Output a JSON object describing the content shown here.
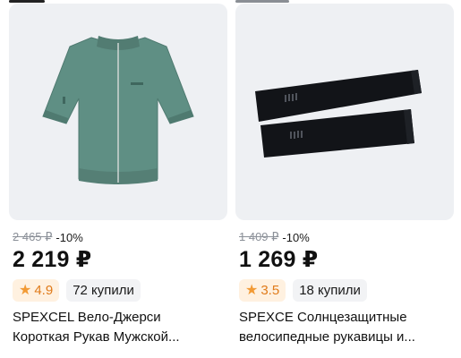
{
  "products": [
    {
      "old_price": "2 465 ₽",
      "discount": "-10%",
      "price": "2 219 ₽",
      "rating": "4.9",
      "bought": "72 купили",
      "title_line1": "SPEXCEL Вело-Джерси",
      "title_line2": "Короткая Рукав Мужской..."
    },
    {
      "old_price": "1 409 ₽",
      "discount": "-10%",
      "price": "1 269 ₽",
      "rating": "3.5",
      "bought": "18 купили",
      "title_line1": "SPEXCE Солнцезащитные",
      "title_line2": "велосипедные рукавицы и..."
    }
  ],
  "colors": {
    "rating_bg": "#fff1e0",
    "rating_text": "#e07b1a",
    "image_bg": "#eef0f3"
  },
  "icons": {
    "rating": "star-icon"
  }
}
